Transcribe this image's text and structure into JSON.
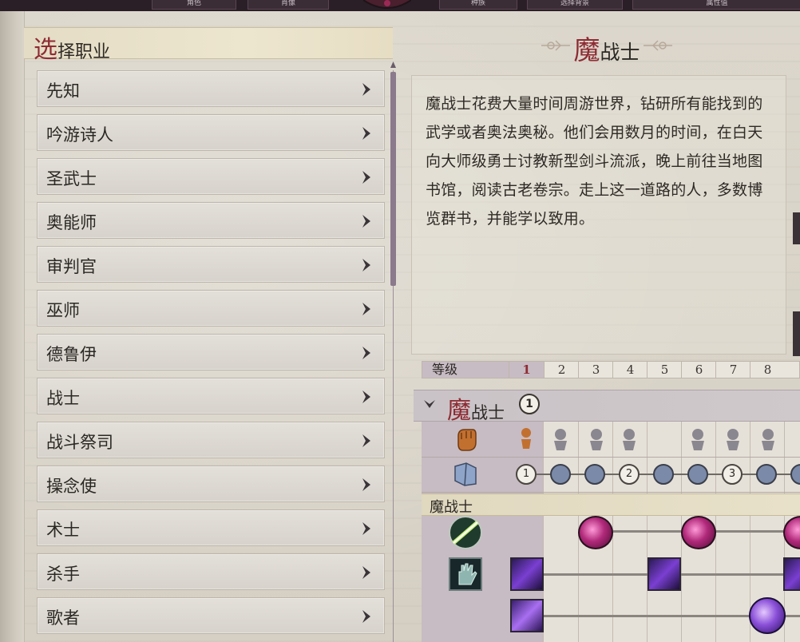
{
  "top_tabs": [
    "角色",
    "肖像",
    "种族",
    "选择背景",
    "属性值"
  ],
  "left_panel": {
    "header_first_char": "选",
    "header_rest": "择职业",
    "classes": [
      "先知",
      "吟游诗人",
      "圣武士",
      "奥能师",
      "审判官",
      "巫师",
      "德鲁伊",
      "战士",
      "战斗祭司",
      "操念使",
      "术士",
      "杀手",
      "歌者"
    ]
  },
  "selected_class": {
    "name_first_char": "魔",
    "name_rest": "战士",
    "description": "魔战士花费大量时间周游世界，钻研所有能找到的武学或者奥法奥秘。他们会用数月的时间，在白天向大师级勇士讨教新型剑斗流派，晚上前往当地图书馆，阅读古老卷宗。走上这一道路的人，多数博览群书，并能学以致用。"
  },
  "level_table": {
    "label": "等级",
    "levels": [
      "1",
      "2",
      "3",
      "4",
      "5",
      "6",
      "7",
      "8"
    ],
    "active_level": "1"
  },
  "progression": {
    "class_first_char": "魔",
    "class_rest": "战士",
    "class_level_badge": "1",
    "bab_markers": [
      "1",
      "2",
      "3"
    ],
    "subclass_label": "魔战士"
  },
  "colors": {
    "accent_red": "#8e2b33",
    "level_highlight": "#c8bcc4",
    "bab_dot": "#7b8aa8"
  },
  "icons": {
    "feat_row": "fist-icon",
    "bab_row": "book-icon",
    "spell_row": "sword-spell-icon",
    "hand_row": "glowing-hand-icon"
  }
}
